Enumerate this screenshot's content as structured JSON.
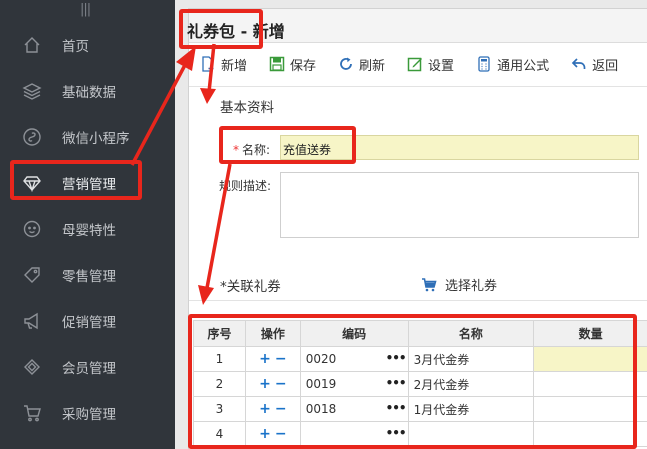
{
  "sidebar": {
    "grip": "|||",
    "items": [
      {
        "label": "首页",
        "icon": "home-icon"
      },
      {
        "label": "基础数据",
        "icon": "layers-icon"
      },
      {
        "label": "微信小程序",
        "icon": "mini-program-icon"
      },
      {
        "label": "营销管理",
        "icon": "diamond-icon",
        "active": true
      },
      {
        "label": "母婴特性",
        "icon": "baby-face-icon"
      },
      {
        "label": "零售管理",
        "icon": "tag-icon"
      },
      {
        "label": "促销管理",
        "icon": "megaphone-icon"
      },
      {
        "label": "会员管理",
        "icon": "gem-icon"
      },
      {
        "label": "采购管理",
        "icon": "cart-icon"
      }
    ]
  },
  "page": {
    "title": "礼券包 - 新增"
  },
  "toolbar": {
    "new_label": "新增",
    "save_label": "保存",
    "refresh_label": "刷新",
    "settings_label": "设置",
    "formula_label": "通用公式",
    "back_label": "返回"
  },
  "form": {
    "section_title": "基本资料",
    "name_label": "名称:",
    "name_value": "充值送券",
    "desc_label": "规则描述:",
    "desc_value": ""
  },
  "coupons": {
    "section_title": "*关联礼券",
    "select_label": "选择礼券",
    "columns": [
      "序号",
      "操作",
      "编码",
      "名称",
      "数量"
    ],
    "rows": [
      {
        "no": "1",
        "code": "0020",
        "name": "3月代金券",
        "qty": ""
      },
      {
        "no": "2",
        "code": "0019",
        "name": "2月代金券",
        "qty": ""
      },
      {
        "no": "3",
        "code": "0018",
        "name": "1月代金券",
        "qty": ""
      },
      {
        "no": "4",
        "code": "",
        "name": "",
        "qty": ""
      }
    ],
    "plus": "+",
    "minus": "−",
    "dots": "•••"
  },
  "colors": {
    "sidebar_bg": "#30353b",
    "annotation_red": "#e8261c",
    "input_yellow": "#f7f5c7",
    "icon_blue": "#1a73c9"
  }
}
